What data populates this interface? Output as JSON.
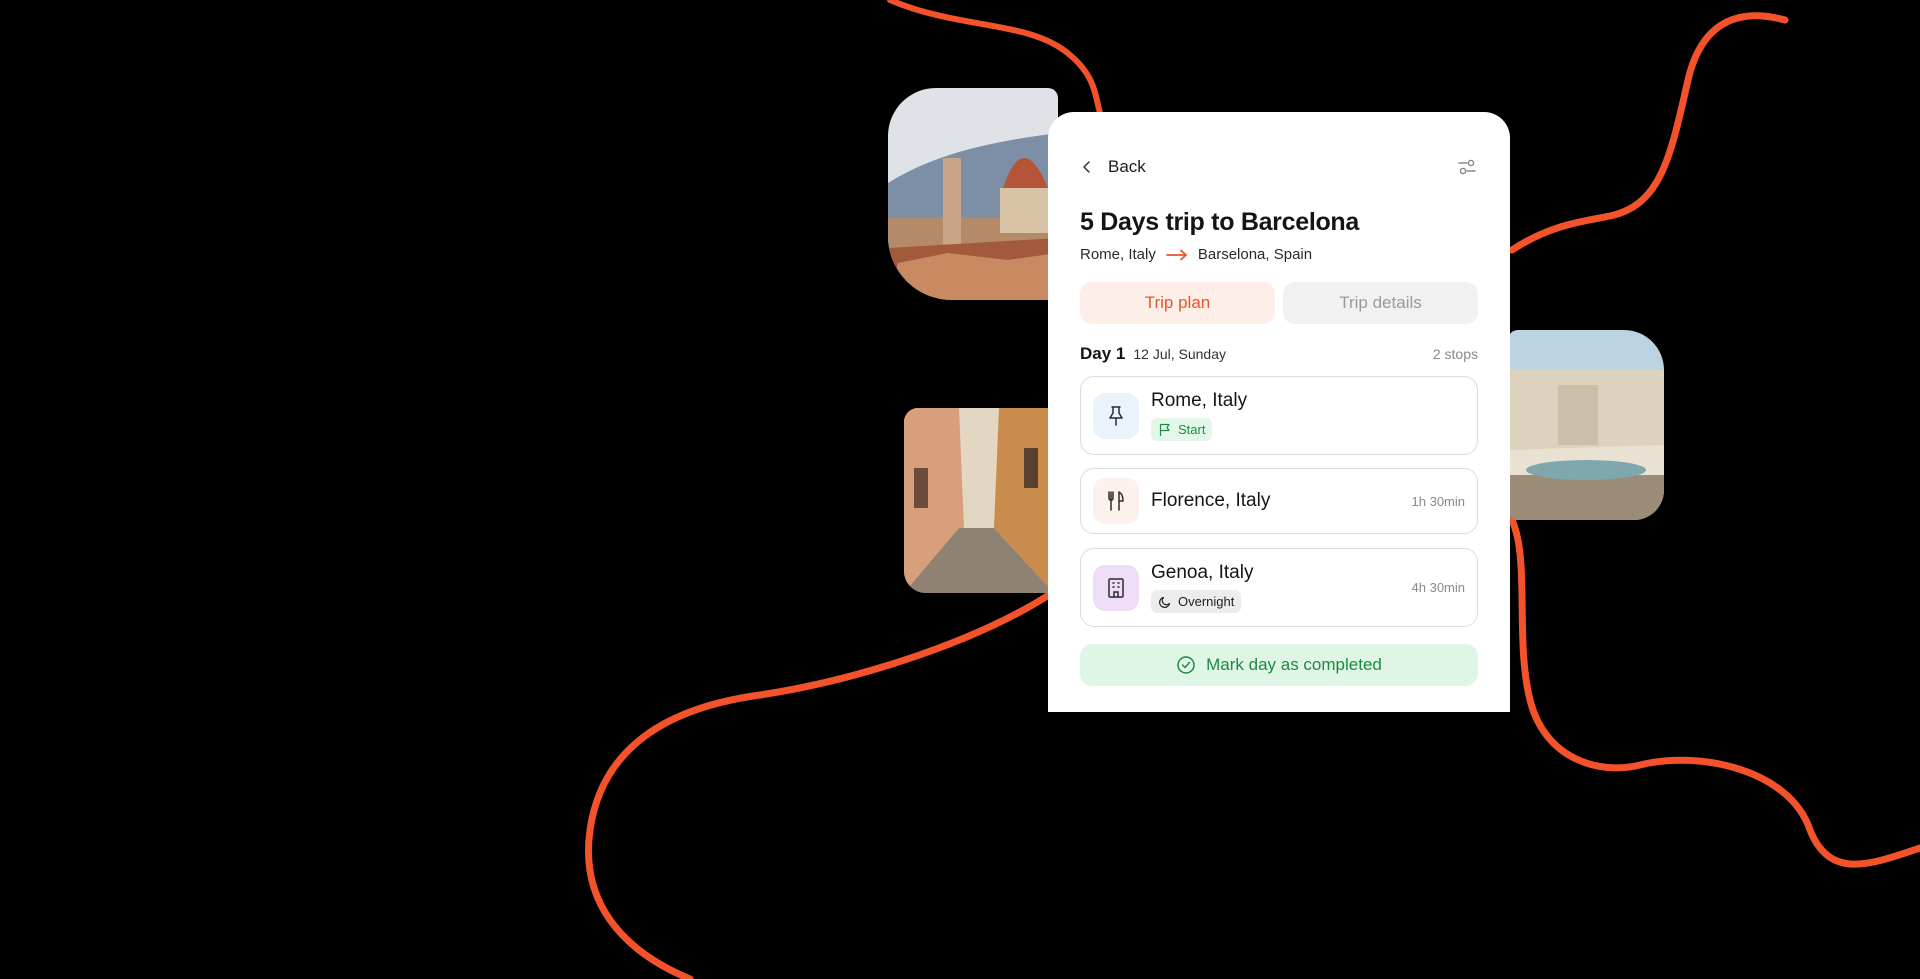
{
  "header": {
    "back_label": "Back"
  },
  "trip": {
    "title": "5 Days trip to Barcelona",
    "origin": "Rome, Italy",
    "destination": "Barselona, Spain"
  },
  "tabs": [
    {
      "label": "Trip plan",
      "active": true
    },
    {
      "label": "Trip details",
      "active": false
    }
  ],
  "day": {
    "label": "Day 1",
    "date": "12 Jul, Sunday",
    "stops_count": "2 stops"
  },
  "stops": [
    {
      "name": "Rome, Italy",
      "icon": "pin-icon",
      "badge": "Start",
      "badge_icon": "flag-icon",
      "duration": ""
    },
    {
      "name": "Florence, Italy",
      "icon": "fork-knife-icon",
      "badge": "",
      "duration": "1h 30min"
    },
    {
      "name": "Genoa, Italy",
      "icon": "hotel-icon",
      "badge": "Overnight",
      "badge_icon": "moon-icon",
      "duration": "4h 30min"
    }
  ],
  "complete_label": "Mark day as completed",
  "colors": {
    "accent": "#e8552d",
    "route_line": "#f4522a",
    "success": "#1d8a43",
    "success_bg": "#dff6e6"
  }
}
